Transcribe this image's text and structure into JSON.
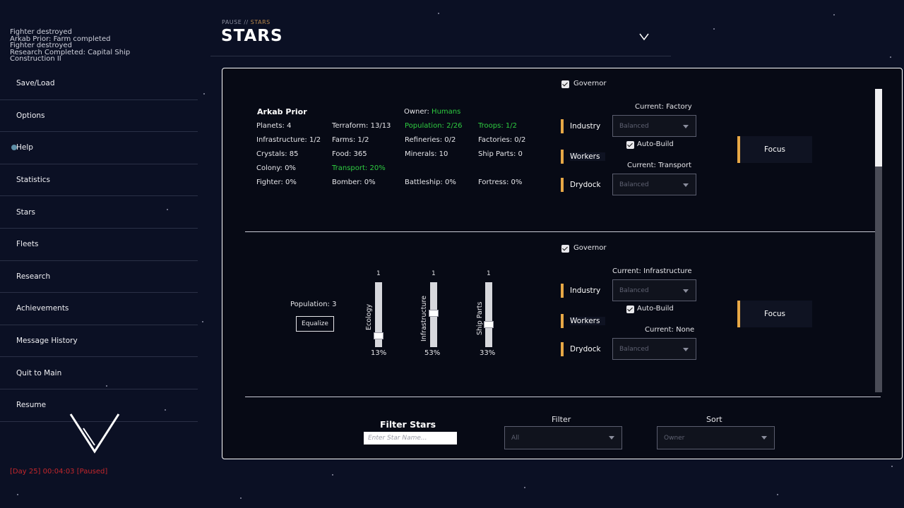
{
  "log": [
    "Fighter destroyed",
    "Arkab Prior: Farm completed",
    "Fighter destroyed",
    "Research Completed: Capital Ship Construction II"
  ],
  "sidebar": {
    "items": [
      {
        "label": "Save/Load"
      },
      {
        "label": "Options"
      },
      {
        "label": "Help"
      },
      {
        "label": "Statistics"
      },
      {
        "label": "Stars"
      },
      {
        "label": "Fleets"
      },
      {
        "label": "Research"
      },
      {
        "label": "Achievements"
      },
      {
        "label": "Message History"
      },
      {
        "label": "Quit to Main"
      },
      {
        "label": "Resume"
      }
    ]
  },
  "status": "[Day 25] 00:04:03 [Paused]",
  "header": {
    "crumb_root": "PAUSE //",
    "crumb_current": " STARS",
    "title": "STARS"
  },
  "star": {
    "name": "Arkab Prior",
    "owner_label": "Owner:",
    "owner_value": "Humans",
    "planets": "Planets: 4",
    "terraform": "Terraform: 13/13",
    "population": "Population: 2/26",
    "troops": "Troops: 1/2",
    "infrastructure": "Infrastructure: 1/2",
    "farms": "Farms: 1/2",
    "refineries": "Refineries: 0/2",
    "factories": "Factories: 0/2",
    "crystals": "Crystals: 85",
    "food": "Food: 365",
    "minerals": "Minerals: 10",
    "ship_parts": "Ship Parts: 0",
    "colony": "Colony: 0%",
    "transport": "Transport: 20%",
    "fighter": "Fighter: 0%",
    "bomber": "Bomber: 0%",
    "battleship": "Battleship: 0%",
    "fortress": "Fortress: 0%"
  },
  "governor1": {
    "governor_label": "Governor",
    "current_top": "Current: Factory",
    "current_bottom": "Current: Transport",
    "industry": "Industry",
    "workers": "Workers",
    "drydock": "Drydock",
    "dd_top": "Balanced",
    "dd_bottom": "Balanced",
    "autobuild": "Auto-Build",
    "focus": "Focus"
  },
  "allocation": {
    "population": "Population: 3",
    "equalize": "Equalize",
    "sliders": [
      {
        "label": "Ecology",
        "max": "1",
        "percent": "13%",
        "value": 0.13
      },
      {
        "label": "Infrastructure",
        "max": "1",
        "percent": "53%",
        "value": 0.53
      },
      {
        "label": "Ship Parts",
        "max": "1",
        "percent": "33%",
        "value": 0.33
      }
    ]
  },
  "governor2": {
    "governor_label": "Governor",
    "current_top": "Current: Infrastructure",
    "current_bottom": "Current: None",
    "industry": "Industry",
    "workers": "Workers",
    "drydock": "Drydock",
    "dd_top": "Balanced",
    "dd_bottom": "Balanced",
    "autobuild": "Auto-Build",
    "focus": "Focus"
  },
  "filter": {
    "title": "Filter Stars",
    "placeholder": "Enter Star Name...",
    "filter_label": "Filter",
    "filter_value": "All",
    "sort_label": "Sort",
    "sort_value": "Owner"
  },
  "colors": {
    "accent": "#e7a846",
    "green": "#2ecc40",
    "status_red": "#c4262b",
    "background": "#0b1024"
  }
}
